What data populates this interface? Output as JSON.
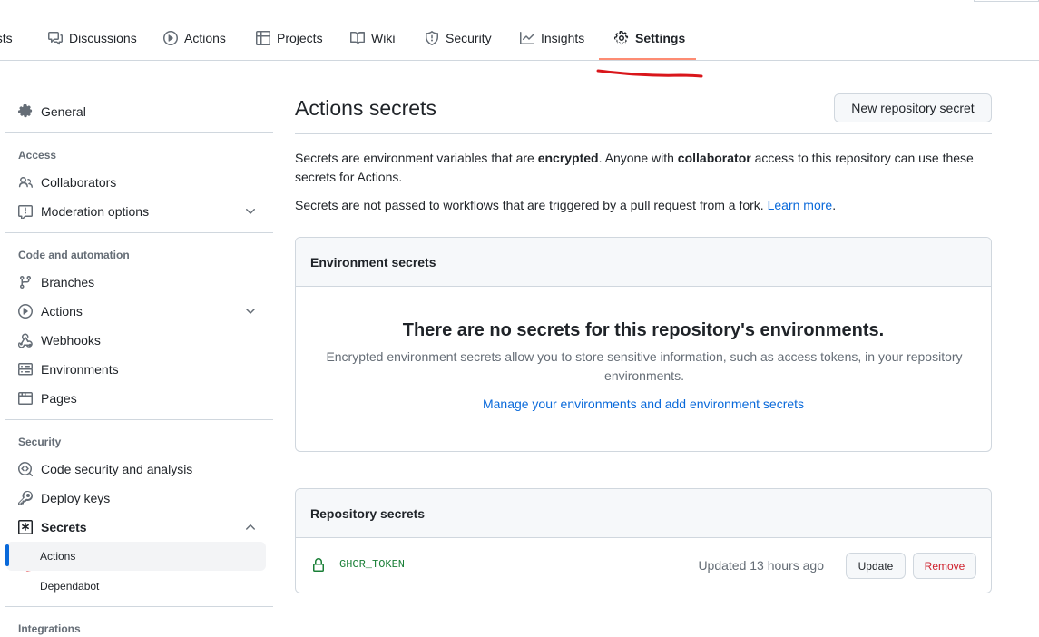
{
  "nav": {
    "tabs": [
      {
        "label": "ests",
        "icon": "pull-request-icon"
      },
      {
        "label": "Discussions",
        "icon": "discussions-icon"
      },
      {
        "label": "Actions",
        "icon": "play-icon"
      },
      {
        "label": "Projects",
        "icon": "table-icon"
      },
      {
        "label": "Wiki",
        "icon": "book-icon"
      },
      {
        "label": "Security",
        "icon": "shield-icon"
      },
      {
        "label": "Insights",
        "icon": "graph-icon"
      },
      {
        "label": "Settings",
        "icon": "gear-icon"
      }
    ],
    "active": "Settings"
  },
  "sidebar": {
    "general": "General",
    "sections": {
      "access": "Access",
      "code_automation": "Code and automation",
      "security": "Security",
      "integrations": "Integrations"
    },
    "items": {
      "collaborators": "Collaborators",
      "moderation": "Moderation options",
      "branches": "Branches",
      "actions": "Actions",
      "webhooks": "Webhooks",
      "environments": "Environments",
      "pages": "Pages",
      "code_security": "Code security and analysis",
      "deploy_keys": "Deploy keys",
      "secrets": "Secrets",
      "secrets_actions": "Actions",
      "secrets_dependabot": "Dependabot"
    }
  },
  "main": {
    "title": "Actions secrets",
    "new_secret_button": "New repository secret",
    "desc1_a": "Secrets are environment variables that are ",
    "desc1_b": "encrypted",
    "desc1_c": ". Anyone with ",
    "desc1_d": "collaborator",
    "desc1_e": " access to this repository can use these secrets for Actions.",
    "desc2": "Secrets are not passed to workflows that are triggered by a pull request from a fork. ",
    "learn_more": "Learn more",
    "desc2_end": ".",
    "env_box": {
      "header": "Environment secrets",
      "blank_title": "There are no secrets for this repository's environments.",
      "blank_text": "Encrypted environment secrets allow you to store sensitive information, such as access tokens, in your repository environments.",
      "link": "Manage your environments and add environment secrets"
    },
    "repo_box": {
      "header": "Repository secrets",
      "secrets": [
        {
          "name": "GHCR_TOKEN",
          "updated": "Updated 13 hours ago",
          "update_label": "Update",
          "remove_label": "Remove"
        }
      ]
    }
  },
  "colors": {
    "accent": "#0969da",
    "success": "#1a7f37",
    "danger": "#cf222e",
    "tab_underline": "#fd8c73",
    "annotation": "#d9161b"
  }
}
